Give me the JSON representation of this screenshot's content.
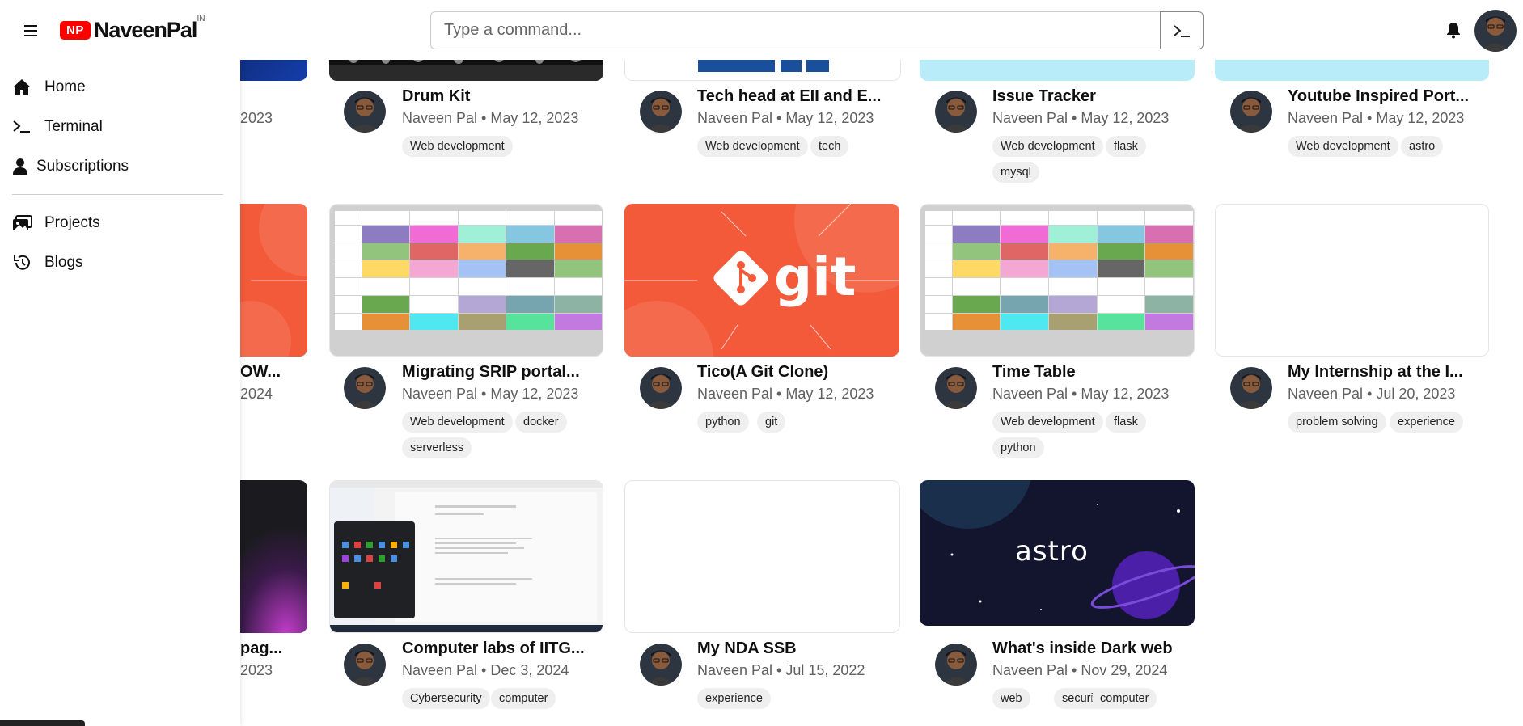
{
  "header": {
    "logo_badge": "NP",
    "logo_text": "NaveenPal",
    "logo_sup": "IN",
    "search_placeholder": "Type a command..."
  },
  "sidebar": {
    "items": [
      {
        "label": "Home",
        "icon": "home-icon"
      },
      {
        "label": "Terminal",
        "icon": "terminal-icon"
      },
      {
        "label": "Subscriptions",
        "icon": "person-icon"
      },
      {
        "label": "Projects",
        "icon": "projects-icon"
      },
      {
        "label": "Blogs",
        "icon": "history-icon"
      }
    ]
  },
  "cards": {
    "row1_partial": {
      "meta": "2023"
    },
    "row2_partial": {
      "title": "OW...",
      "meta": "2024"
    },
    "row3_partial": {
      "title": "pag...",
      "meta": "2023"
    },
    "c1": {
      "title": "Drum Kit",
      "meta": "Naveen Pal • May 12, 2023",
      "tags": [
        "Web development"
      ]
    },
    "c2": {
      "title": "Tech head at EII and E...",
      "meta": "Naveen Pal • May 12, 2023",
      "tags": [
        "Web development",
        "tech"
      ]
    },
    "c3": {
      "title": "Issue Tracker",
      "meta": "Naveen Pal • May 12, 2023",
      "tags": [
        "Web development",
        "flask",
        "mysql"
      ]
    },
    "c4": {
      "title": "Youtube Inspired Port...",
      "meta": "Naveen Pal • May 12, 2023",
      "tags": [
        "Web development",
        "astro"
      ]
    },
    "c5": {
      "title": "Migrating SRIP portal...",
      "meta": "Naveen Pal • May 12, 2023",
      "tags": [
        "Web development",
        "docker",
        "serverless"
      ]
    },
    "c6": {
      "title": "Tico(A Git Clone)",
      "meta": "Naveen Pal • May 12, 2023",
      "tags": [
        "python",
        "git"
      ],
      "thumb_text": "git"
    },
    "c7": {
      "title": "Time Table",
      "meta": "Naveen Pal • May 12, 2023",
      "tags": [
        "Web development",
        "flask",
        "python"
      ]
    },
    "c8": {
      "title": "My Internship at the I...",
      "meta": "Naveen Pal • Jul 20, 2023",
      "tags": [
        "problem solving",
        "experience"
      ]
    },
    "c9": {
      "title": "Computer labs of IITG...",
      "meta": "Naveen Pal • Dec 3, 2024",
      "tags": [
        "Cybersecurity",
        "computer"
      ]
    },
    "c10": {
      "title": "My NDA SSB",
      "meta": "Naveen Pal • Jul 15, 2022",
      "tags": [
        "experience"
      ]
    },
    "c11": {
      "title": "What's inside Dark web",
      "meta": "Naveen Pal • Nov 29, 2024",
      "tags": [
        "web",
        "security",
        "computer"
      ],
      "thumb_text": "astro"
    }
  },
  "colors": {
    "brand": "#ff0000",
    "git_orange": "#f05133",
    "astro_bg": "#13152e"
  }
}
